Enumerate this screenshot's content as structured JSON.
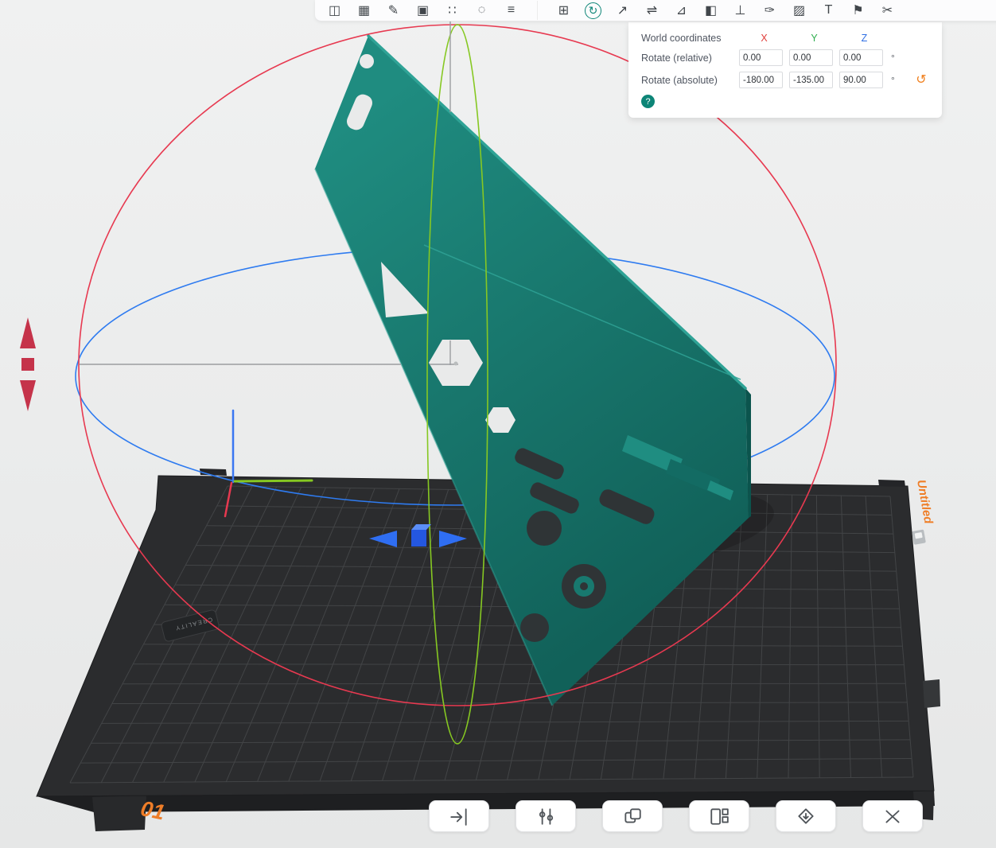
{
  "top_toolbar": {
    "groups": [
      {
        "name": "view-group",
        "icons": [
          {
            "name": "model-view-icon",
            "glyph": "◫"
          },
          {
            "name": "grid-view-icon",
            "glyph": "▦"
          },
          {
            "name": "sketch-icon",
            "glyph": "✎"
          },
          {
            "name": "snapshot-icon",
            "glyph": "▣"
          },
          {
            "name": "lattice-icon",
            "glyph": "∷"
          },
          {
            "name": "dotted-circle-icon",
            "glyph": "◌"
          },
          {
            "name": "list-icon",
            "glyph": "≡"
          }
        ]
      },
      {
        "name": "transform-group",
        "icons": [
          {
            "name": "move-tool-icon",
            "glyph": "⊞"
          },
          {
            "name": "rotate-tool-icon",
            "glyph": "↻",
            "active": true
          },
          {
            "name": "scale-tool-icon",
            "glyph": "↗"
          },
          {
            "name": "mirror-tool-icon",
            "glyph": "⇌"
          },
          {
            "name": "measure-tool-icon",
            "glyph": "⊿"
          },
          {
            "name": "clone-tool-icon",
            "glyph": "◧"
          },
          {
            "name": "support-tool-icon",
            "glyph": "⊥"
          },
          {
            "name": "paint-tool-icon",
            "glyph": "✑"
          },
          {
            "name": "hatch-tool-icon",
            "glyph": "▨"
          },
          {
            "name": "text-tool-icon",
            "glyph": "T"
          },
          {
            "name": "flag-tool-icon",
            "glyph": "⚑"
          },
          {
            "name": "cut-tool-icon",
            "glyph": "✂"
          }
        ]
      }
    ]
  },
  "rotate_panel": {
    "world_label": "World coordinates",
    "axes": [
      {
        "label": "X",
        "color": "#e03e3a"
      },
      {
        "label": "Y",
        "color": "#2fae4e"
      },
      {
        "label": "Z",
        "color": "#2f6fe4"
      }
    ],
    "relative_row": {
      "label": "Rotate (relative)",
      "x": "0.00",
      "y": "0.00",
      "z": "0.00",
      "unit": "°"
    },
    "absolute_row": {
      "label": "Rotate (absolute)",
      "x": "-180.00",
      "y": "-135.00",
      "z": "90.00",
      "unit": "°"
    },
    "reset_glyph": "↺",
    "help_glyph": "?"
  },
  "viewport": {
    "plate_name": "Untitled",
    "plate_number": "01",
    "brand": "CREALITY",
    "model_color": "#17796f",
    "gizmo_colors": {
      "x": "#e73950",
      "y": "#86c822",
      "z": "#2e7bf0"
    }
  },
  "bottom_toolbar": {
    "buttons": [
      {
        "name": "lay-on-face-button"
      },
      {
        "name": "drop-pins-button"
      },
      {
        "name": "clone-button"
      },
      {
        "name": "arrange-button"
      },
      {
        "name": "auto-orient-button"
      },
      {
        "name": "delete-button"
      }
    ]
  }
}
